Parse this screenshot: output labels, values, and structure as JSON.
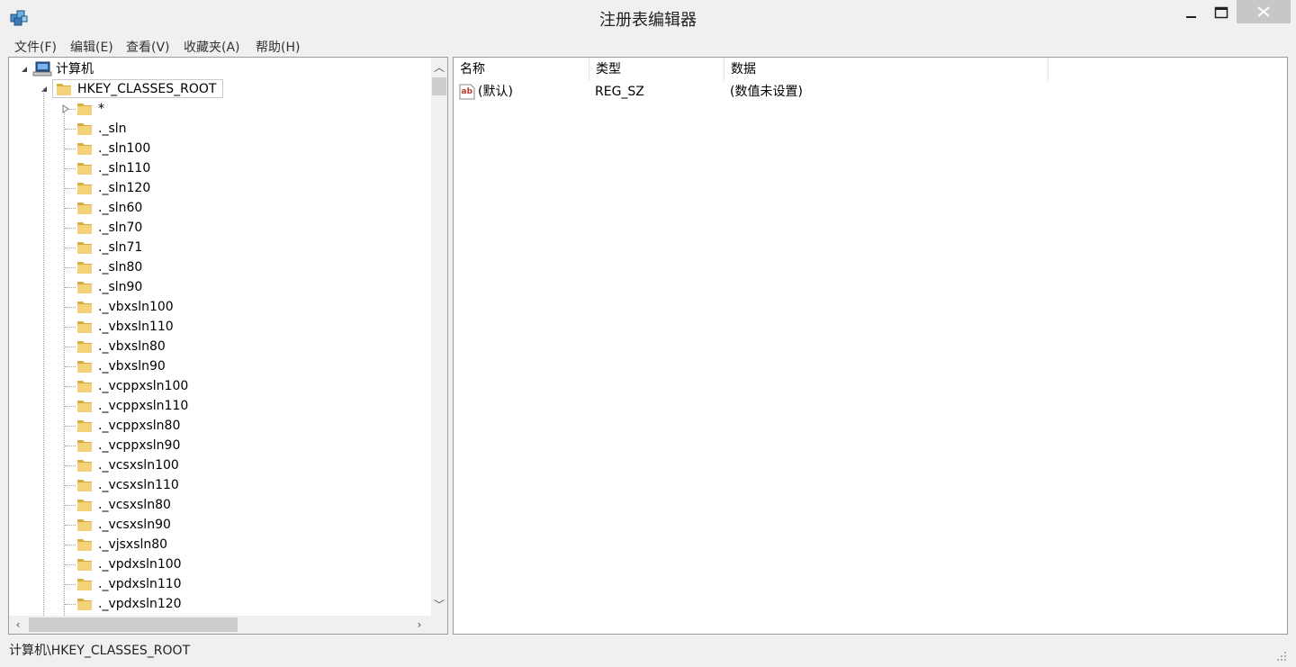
{
  "window": {
    "title": "注册表编辑器"
  },
  "menu": [
    {
      "label": "文件(F)"
    },
    {
      "label": "编辑(E)"
    },
    {
      "label": "查看(V)"
    },
    {
      "label": "收藏夹(A)"
    },
    {
      "label": "帮助(H)"
    }
  ],
  "tree": {
    "root": "计算机",
    "hive": "HKEY_CLASSES_ROOT",
    "keys": [
      "*",
      "._sln",
      "._sln100",
      "._sln110",
      "._sln120",
      "._sln60",
      "._sln70",
      "._sln71",
      "._sln80",
      "._sln90",
      "._vbxsln100",
      "._vbxsln110",
      "._vbxsln80",
      "._vbxsln90",
      "._vcppxsln100",
      "._vcppxsln110",
      "._vcppxsln80",
      "._vcppxsln90",
      "._vcsxsln100",
      "._vcsxsln110",
      "._vcsxsln80",
      "._vcsxsln90",
      "._vjsxsln80",
      "._vpdxsln100",
      "._vpdxsln110",
      "._vpdxsln120"
    ]
  },
  "list": {
    "columns": [
      "名称",
      "类型",
      "数据"
    ],
    "rows": [
      {
        "name": "(默认)",
        "type": "REG_SZ",
        "data": "(数值未设置)"
      }
    ]
  },
  "status": {
    "path": "计算机\\HKEY_CLASSES_ROOT"
  },
  "colors": {
    "folder": "#f3d27a",
    "folder_dark": "#d8ad3f",
    "selection_border": "#c9c9c9"
  }
}
